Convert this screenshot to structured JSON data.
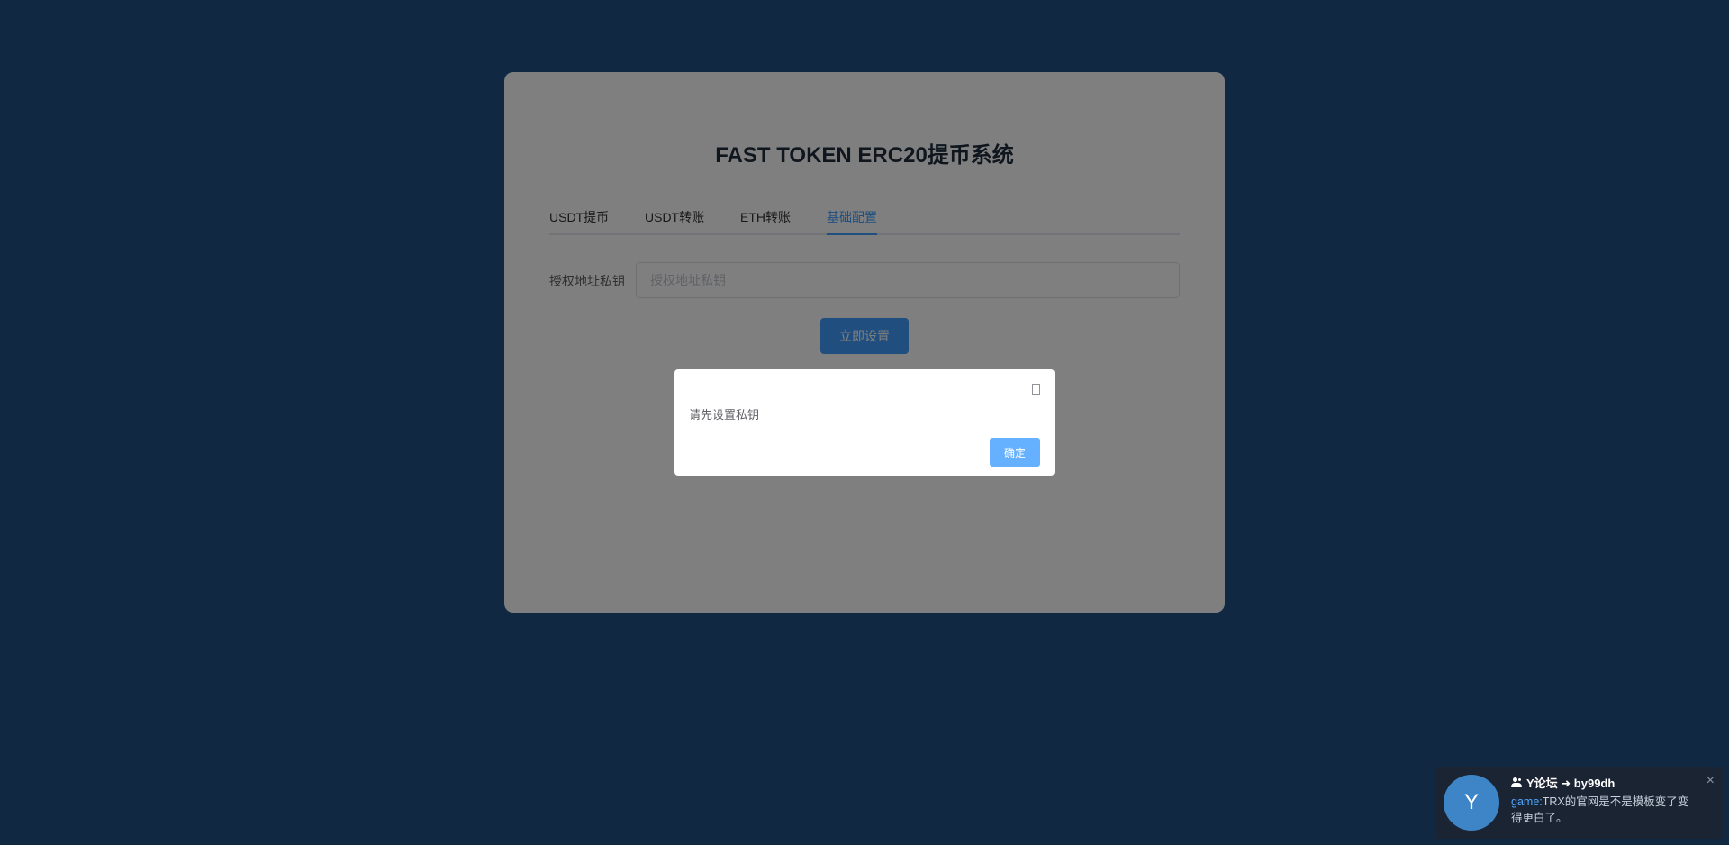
{
  "card": {
    "title": "FAST TOKEN ERC20提币系统",
    "tabs": [
      {
        "label": "USDT提币",
        "active": false
      },
      {
        "label": "USDT转账",
        "active": false
      },
      {
        "label": "ETH转账",
        "active": false
      },
      {
        "label": "基础配置",
        "active": true
      }
    ],
    "form": {
      "private_key_label": "授权地址私钥",
      "private_key_placeholder": "授权地址私钥",
      "private_key_value": "",
      "submit_label": "立即设置"
    }
  },
  "dialog": {
    "message": "请先设置私钥",
    "ok_label": "确定",
    "close_icon": "close-icon"
  },
  "toast": {
    "avatar_letter": "Y",
    "icon": "users-icon",
    "title": "Y论坛 ➜ by99dh",
    "user": "game:",
    "message": "TRX的官网是不是模板变了变得更白了。",
    "close_label": "×"
  },
  "colors": {
    "page_background": "#215082",
    "primary": "#409eff",
    "toast_background": "#1b2433",
    "avatar": "#3d85c6"
  }
}
